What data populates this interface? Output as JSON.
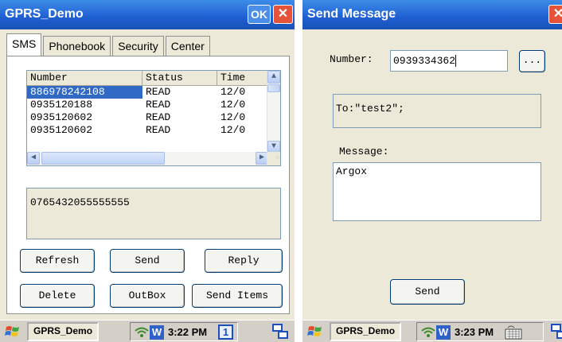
{
  "left_window": {
    "title": "GPRS_Demo",
    "ok_label": "OK",
    "close_label": "✕",
    "tabs": [
      "SMS",
      "Phonebook",
      "Security",
      "Center"
    ],
    "list": {
      "columns": [
        "Number",
        "Status",
        "Time"
      ],
      "rows": [
        {
          "number": "886978242108",
          "status": "READ",
          "time": "12/0"
        },
        {
          "number": "0935120188",
          "status": "READ",
          "time": "12/0"
        },
        {
          "number": "0935120602",
          "status": "READ",
          "time": "12/0"
        },
        {
          "number": "0935120602",
          "status": "READ",
          "time": "12/0"
        }
      ]
    },
    "message_text": "0765432055555555",
    "buttons": {
      "refresh": "Refresh",
      "send": "Send",
      "reply": "Reply",
      "delete": "Delete",
      "outbox": "OutBox",
      "send_items": "Send Items"
    },
    "taskbar": {
      "app": "GPRS_Demo",
      "time": "3:22 PM",
      "input_indicator": "1"
    }
  },
  "right_window": {
    "title": "Send Message",
    "close_label": "✕",
    "number_label": "Number:",
    "number_value": "0939334362",
    "browse_label": "...",
    "to_text": "To:\"test2\";",
    "message_label": "Message:",
    "message_value": "Argox",
    "send_label": "Send",
    "taskbar": {
      "app": "GPRS_Demo",
      "time": "3:23 PM"
    }
  },
  "colors": {
    "titlebar": "#1f5fd1",
    "selection": "#316ac5",
    "close": "#e5533a"
  }
}
